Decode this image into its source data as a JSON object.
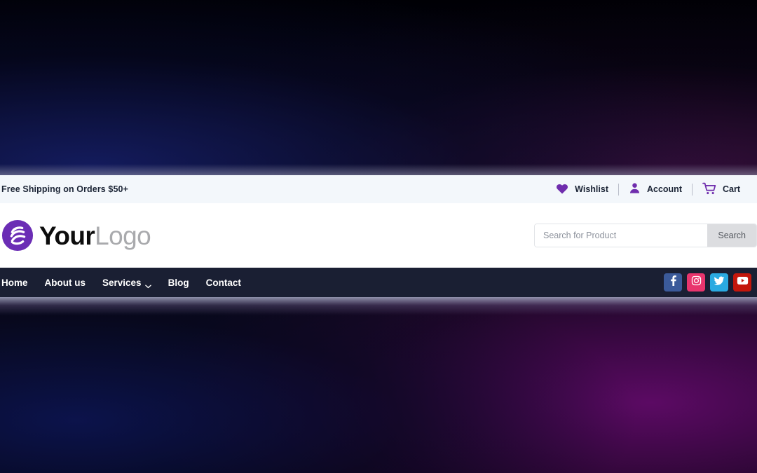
{
  "topbar": {
    "promo": "Free Shipping on Orders $50+",
    "links": [
      {
        "label": "Wishlist",
        "icon": "heart-icon"
      },
      {
        "label": "Account",
        "icon": "user-icon"
      },
      {
        "label": "Cart",
        "icon": "cart-icon"
      }
    ]
  },
  "header": {
    "logo": {
      "primary": "Your",
      "secondary": "Logo",
      "mark": "swirl-s-logo-icon"
    },
    "search": {
      "placeholder": "Search for Product",
      "value": "",
      "button_label": "Search"
    }
  },
  "nav": {
    "items": [
      {
        "label": "Home",
        "has_dropdown": false
      },
      {
        "label": "About us",
        "has_dropdown": false
      },
      {
        "label": "Services",
        "has_dropdown": true
      },
      {
        "label": "Blog",
        "has_dropdown": false
      },
      {
        "label": "Contact",
        "has_dropdown": false
      }
    ],
    "socials": [
      {
        "name": "facebook",
        "color": "#3b5a9a"
      },
      {
        "name": "instagram",
        "color": "#e8356d"
      },
      {
        "name": "twitter",
        "color": "#2aaae1"
      },
      {
        "name": "youtube",
        "color": "#c4170c"
      }
    ]
  },
  "colors": {
    "accent_purple": "#6f2dad",
    "topbar_bg": "#f3f7fb",
    "nav_bg": "#1a1f33",
    "search_btn_bg": "#dcdde0"
  }
}
